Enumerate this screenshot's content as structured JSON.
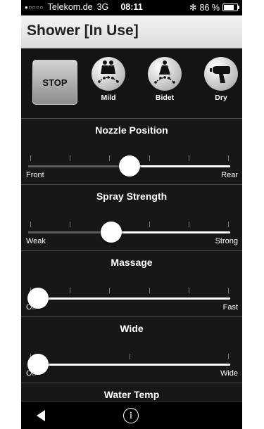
{
  "status_bar": {
    "signal": "●○○○○",
    "carrier": "Telekom.de",
    "network": "3G",
    "time": "08:11",
    "bluetooth": "✻",
    "battery_percent": "86 %",
    "battery_level": 0.86
  },
  "header": {
    "title": "Shower [In Use]"
  },
  "actions": {
    "stop_label": "STOP",
    "modes": [
      {
        "label": "Mild",
        "icon": "mild-mode-icon"
      },
      {
        "label": "Bidet",
        "icon": "bidet-mode-icon"
      },
      {
        "label": "Dry",
        "icon": "hair-dryer-icon"
      }
    ]
  },
  "sliders": [
    {
      "title": "Nozzle Position",
      "min_label": "Front",
      "max_label": "Rear",
      "ticks": 6,
      "value": 0.5
    },
    {
      "title": "Spray Strength",
      "min_label": "Weak",
      "max_label": "Strong",
      "ticks": 6,
      "value": 0.4
    },
    {
      "title": "Massage",
      "min_label": "Off",
      "max_label": "Fast",
      "ticks": 6,
      "value": 0.0
    },
    {
      "title": "Wide",
      "min_label": "Off",
      "max_label": "Wide",
      "ticks": 3,
      "value": 0.0
    }
  ],
  "partial_section": {
    "title": "Water Temp"
  },
  "bottom_bar": {
    "back_icon": "back-arrow-icon",
    "info_icon": "info-icon",
    "info_glyph": "i"
  }
}
